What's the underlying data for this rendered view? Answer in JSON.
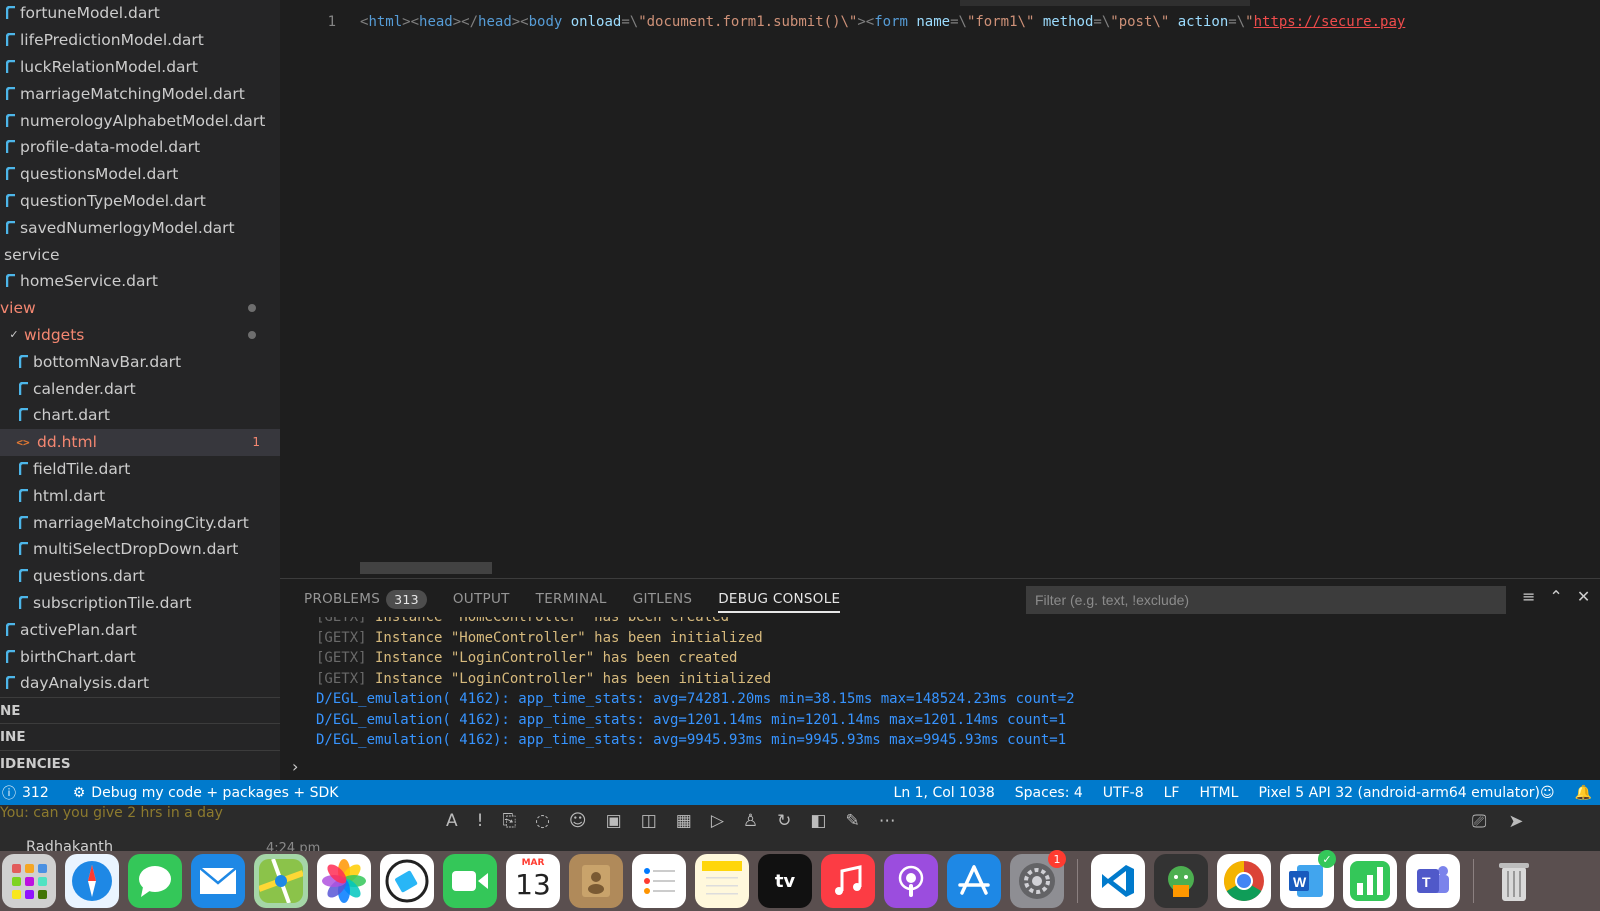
{
  "sidebar": {
    "items": [
      {
        "label": "fortuneModel.dart",
        "type": "dart",
        "level": 1
      },
      {
        "label": "lifePredictionModel.dart",
        "type": "dart",
        "level": 1
      },
      {
        "label": "luckRelationModel.dart",
        "type": "dart",
        "level": 1
      },
      {
        "label": "marriageMatchingModel.dart",
        "type": "dart",
        "level": 1
      },
      {
        "label": "numerologyAlphabetModel.dart",
        "type": "dart",
        "level": 1
      },
      {
        "label": "profile-data-model.dart",
        "type": "dart",
        "level": 1
      },
      {
        "label": "questionsModel.dart",
        "type": "dart",
        "level": 1
      },
      {
        "label": "questionTypeModel.dart",
        "type": "dart",
        "level": 1
      },
      {
        "label": "savedNumerlogyModel.dart",
        "type": "dart",
        "level": 1
      },
      {
        "label": "service",
        "type": "folder",
        "level": 0
      },
      {
        "label": "homeService.dart",
        "type": "dart",
        "level": 1
      },
      {
        "label": "view",
        "type": "folder-modified",
        "level": 0
      },
      {
        "label": "widgets",
        "type": "folder-modified",
        "level": 1
      },
      {
        "label": "bottomNavBar.dart",
        "type": "dart",
        "level": 2
      },
      {
        "label": "calender.dart",
        "type": "dart",
        "level": 2
      },
      {
        "label": "chart.dart",
        "type": "dart",
        "level": 2
      },
      {
        "label": "dd.html",
        "type": "html",
        "level": 2,
        "count": "1"
      },
      {
        "label": "fieldTile.dart",
        "type": "dart",
        "level": 2
      },
      {
        "label": "html.dart",
        "type": "dart",
        "level": 2
      },
      {
        "label": "marriageMatchoingCity.dart",
        "type": "dart",
        "level": 2
      },
      {
        "label": "multiSelectDropDown.dart",
        "type": "dart",
        "level": 2
      },
      {
        "label": "questions.dart",
        "type": "dart",
        "level": 2
      },
      {
        "label": "subscriptionTile.dart",
        "type": "dart",
        "level": 2
      },
      {
        "label": "activePlan.dart",
        "type": "dart",
        "level": 1
      },
      {
        "label": "birthChart.dart",
        "type": "dart",
        "level": 1
      },
      {
        "label": "dayAnalysis.dart",
        "type": "dart",
        "level": 1
      }
    ],
    "sections": [
      "NE",
      "INE",
      "IDENCIES"
    ]
  },
  "editor": {
    "line_number": "1",
    "tokens": [
      {
        "t": "<",
        "c": "punct"
      },
      {
        "t": "html",
        "c": "tag"
      },
      {
        "t": "><",
        "c": "punct"
      },
      {
        "t": "head",
        "c": "tag"
      },
      {
        "t": "></",
        "c": "punct"
      },
      {
        "t": "head",
        "c": "tag"
      },
      {
        "t": "><",
        "c": "punct"
      },
      {
        "t": "body",
        "c": "tag"
      },
      {
        "t": " onload",
        "c": "attr"
      },
      {
        "t": "=\\",
        "c": "punct"
      },
      {
        "t": "\"document.form1.submit()\\\"",
        "c": "str"
      },
      {
        "t": "><",
        "c": "punct"
      },
      {
        "t": "form",
        "c": "tag"
      },
      {
        "t": " name",
        "c": "attr"
      },
      {
        "t": "=\\",
        "c": "punct"
      },
      {
        "t": "\"form1\\\"",
        "c": "str"
      },
      {
        "t": " method",
        "c": "attr"
      },
      {
        "t": "=\\",
        "c": "punct"
      },
      {
        "t": "\"post\\\"",
        "c": "str"
      },
      {
        "t": " action",
        "c": "attr"
      },
      {
        "t": "=\\",
        "c": "punct"
      },
      {
        "t": "\"",
        "c": "str"
      },
      {
        "t": "https://secure.pay",
        "c": "url"
      }
    ]
  },
  "panel": {
    "tabs": [
      {
        "label": "PROBLEMS",
        "badge": "313"
      },
      {
        "label": "OUTPUT"
      },
      {
        "label": "TERMINAL"
      },
      {
        "label": "GITLENS"
      },
      {
        "label": "DEBUG CONSOLE",
        "active": true
      }
    ],
    "filter_placeholder": "Filter (e.g. text, !exclude)",
    "console_lines": [
      {
        "tag": "[GETX]",
        "text": " Instance \"HomeController\" has been created",
        "kind": "getx"
      },
      {
        "tag": "[GETX]",
        "text": " Instance \"HomeController\" has been initialized",
        "kind": "getx"
      },
      {
        "tag": "[GETX]",
        "text": " Instance \"LoginController\" has been created",
        "kind": "getx"
      },
      {
        "tag": "[GETX]",
        "text": " Instance \"LoginController\" has been initialized",
        "kind": "getx"
      },
      {
        "text": "D/EGL_emulation( 4162): app_time_stats: avg=74281.20ms min=38.15ms max=148524.23ms count=2",
        "kind": "egl"
      },
      {
        "text": "D/EGL_emulation( 4162): app_time_stats: avg=1201.14ms min=1201.14ms max=1201.14ms count=1",
        "kind": "egl"
      },
      {
        "text": "D/EGL_emulation( 4162): app_time_stats: avg=9945.93ms min=9945.93ms max=9945.93ms count=1",
        "kind": "egl"
      }
    ],
    "prompt": "›"
  },
  "statusbar": {
    "errors": "312",
    "debug_config": "Debug my code + packages + SDK",
    "position": "Ln 1, Col 1038",
    "spaces": "Spaces: 4",
    "encoding": "UTF-8",
    "eol": "LF",
    "language": "HTML",
    "device": "Pixel 5 API 32 (android-arm64 emulator)"
  },
  "underlay": {
    "preview": "You: can you give 2 hrs in a day",
    "name": "Radhakanth",
    "time": "4:24 pm"
  },
  "dock": {
    "calendar_month": "MAR",
    "calendar_day": "13",
    "settings_badge": "1",
    "appletv_label": "tv"
  },
  "colors": {
    "statusbar": "#007acc",
    "accent_red": "#f48771",
    "getx_text": "#d7ba7d",
    "egl_text": "#3794ff"
  }
}
